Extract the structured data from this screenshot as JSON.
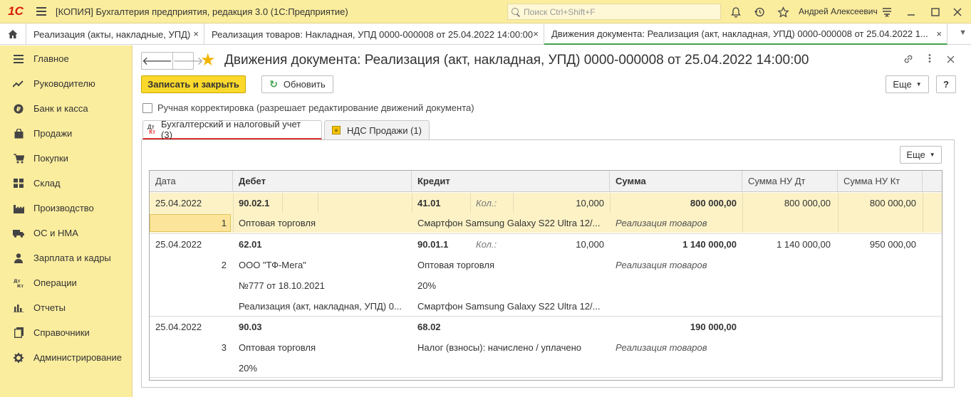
{
  "app": {
    "title": "[КОПИЯ] Бухгалтерия предприятия, редакция 3.0  (1С:Предприятие)",
    "logo": "1С",
    "search_placeholder": "Поиск Ctrl+Shift+F",
    "user": "Андрей Алексеевич"
  },
  "tabs": [
    {
      "label": "Реализация (акты, накладные, УПД)",
      "close": "×"
    },
    {
      "label": "Реализация товаров: Накладная, УПД 0000-000008 от 25.04.2022 14:00:00",
      "close": "×"
    },
    {
      "label": "Движения документа: Реализация (акт, накладная, УПД) 0000-000008 от 25.04.2022 1...",
      "close": "×"
    }
  ],
  "sidebar": {
    "items": [
      {
        "label": "Главное"
      },
      {
        "label": "Руководителю"
      },
      {
        "label": "Банк и касса"
      },
      {
        "label": "Продажи"
      },
      {
        "label": "Покупки"
      },
      {
        "label": "Склад"
      },
      {
        "label": "Производство"
      },
      {
        "label": "ОС и НМА"
      },
      {
        "label": "Зарплата и кадры"
      },
      {
        "label": "Операции"
      },
      {
        "label": "Отчеты"
      },
      {
        "label": "Справочники"
      },
      {
        "label": "Администрирование"
      }
    ]
  },
  "form": {
    "title": "Движения документа: Реализация (акт, накладная, УПД) 0000-000008 от 25.04.2022 14:00:00",
    "save_close": "Записать и закрыть",
    "refresh": "Обновить",
    "more": "Еще",
    "help": "?",
    "manual_checkbox": "Ручная корректировка (разрешает редактирование движений документа)",
    "form_tabs": [
      {
        "label": "Бухгалтерский и налоговый учет (3)"
      },
      {
        "label": "НДС Продажи (1)"
      }
    ],
    "grid_more": "Еще"
  },
  "grid": {
    "columns": [
      "Дата",
      "Дебет",
      "Кредит",
      "Сумма",
      "Сумма НУ Дт",
      "Сумма НУ Кт"
    ],
    "qty_label": "Кол.:",
    "rows": [
      {
        "date": "25.04.2022",
        "num": "1",
        "debit": [
          "90.02.1",
          "Оптовая торговля"
        ],
        "credit": [
          "41.01",
          "Смартфон Samsung Galaxy S22 Ultra 12/..."
        ],
        "qty": "10,000",
        "sum": "800 000,00",
        "content": "Реализация товаров",
        "nu_dt": "800 000,00",
        "nu_kt": "800 000,00"
      },
      {
        "date": "25.04.2022",
        "num": "2",
        "debit": [
          "62.01",
          "ООО \"ТФ-Мега\"",
          "№777 от 18.10.2021",
          "Реализация (акт, накладная, УПД) 0..."
        ],
        "credit": [
          "90.01.1",
          "Оптовая торговля",
          "20%",
          "Смартфон Samsung Galaxy S22 Ultra 12/..."
        ],
        "qty": "10,000",
        "sum": "1 140 000,00",
        "content": "Реализация товаров",
        "nu_dt": "1 140 000,00",
        "nu_kt": "950 000,00"
      },
      {
        "date": "25.04.2022",
        "num": "3",
        "debit": [
          "90.03",
          "Оптовая торговля",
          "20%"
        ],
        "credit": [
          "68.02",
          "Налог (взносы): начислено / уплачено"
        ],
        "sum": "190 000,00",
        "content": "Реализация товаров"
      }
    ]
  }
}
